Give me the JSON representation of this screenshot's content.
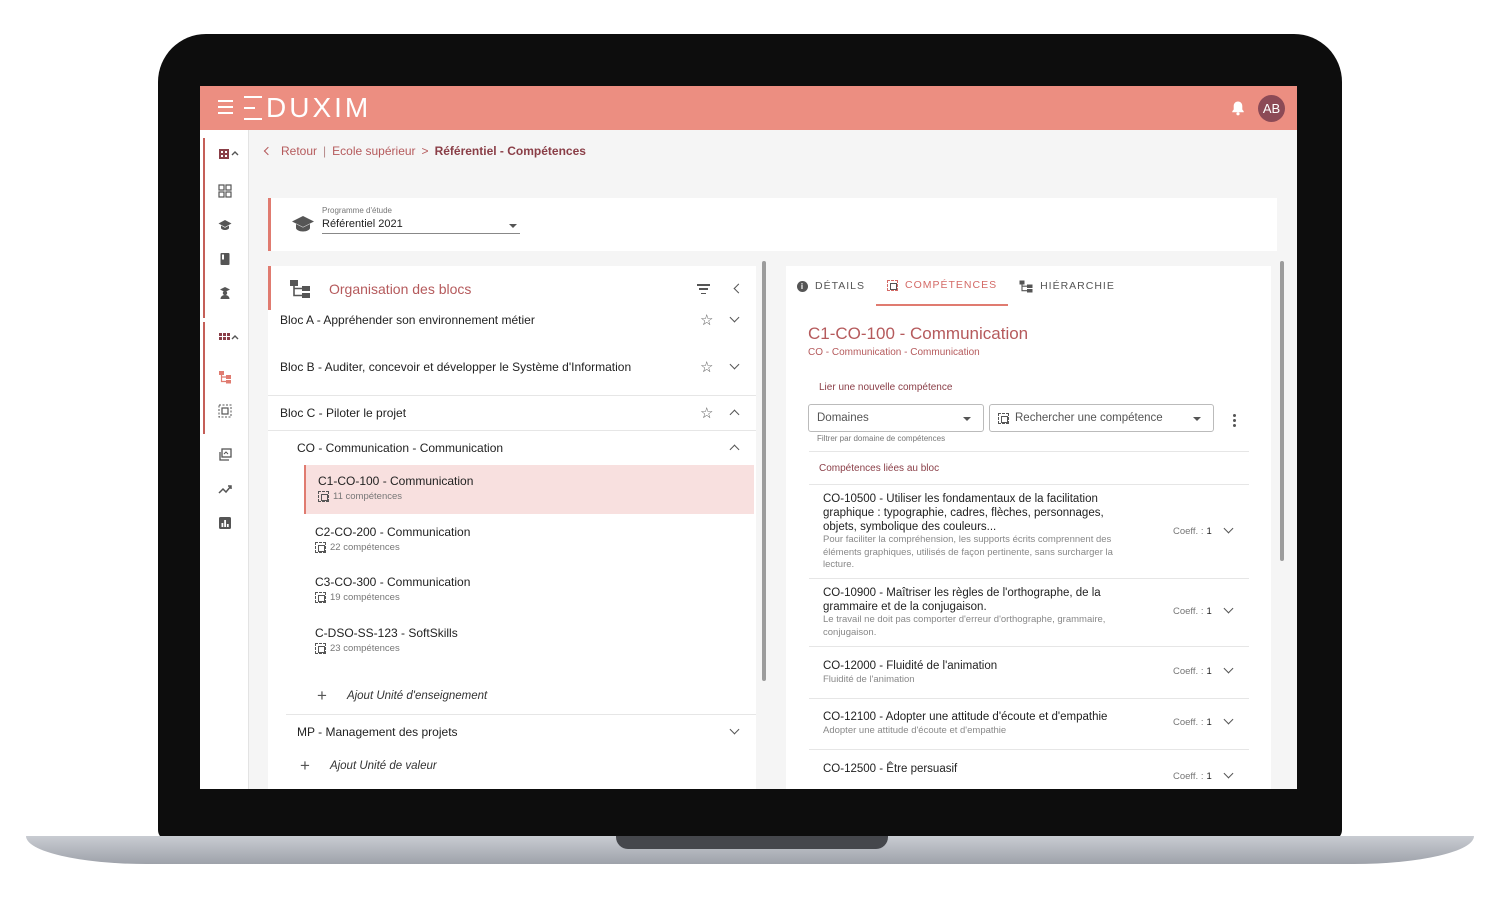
{
  "app": {
    "logo": "DUXIM",
    "user_initials": "AB"
  },
  "breadcrumb": {
    "back": "Retour",
    "sep": "|",
    "school": "Ecole supérieur",
    "arrow": ">",
    "current": "Référentiel - Compétences"
  },
  "program": {
    "label": "Programme d'étude",
    "value": "Référentiel 2021"
  },
  "blocks_panel": {
    "title": "Organisation des blocs",
    "blocs": [
      {
        "label": "Bloc A - Appréhender son environnement métier"
      },
      {
        "label": "Bloc B - Auditer, concevoir et développer le Système d'Information"
      },
      {
        "label": "Bloc C - Piloter le projet"
      }
    ],
    "group": "CO - Communication - Communication",
    "units": [
      {
        "title": "C1-CO-100 - Communication",
        "count": "11 compétences"
      },
      {
        "title": "C2-CO-200 - Communication",
        "count": "22 compétences"
      },
      {
        "title": "C3-CO-300 - Communication",
        "count": "19 compétences"
      },
      {
        "title": "C-DSO-SS-123 - SoftSkills",
        "count": "23 compétences"
      }
    ],
    "add_unit": "Ajout Unité d'enseignement",
    "group2": "MP - Management des projets",
    "add_value": "Ajout Unité de valeur"
  },
  "details_panel": {
    "tabs": [
      "DÉTAILS",
      "COMPÉTENCES",
      "HIÉRARCHIE"
    ],
    "active_tab": "COMPÉTENCES",
    "title": "C1-CO-100 - Communication",
    "subtitle": "CO - Communication - Communication",
    "link_label": "Lier une nouvelle compétence",
    "domains_select": "Domaines",
    "search_select": "Rechercher une compétence",
    "hint": "Filtrer par domaine de compétences",
    "section_title": "Compétences liées au bloc",
    "coeff_label": "Coeff. :",
    "competences": [
      {
        "title": "CO-10500 - Utiliser les fondamentaux de la facilitation graphique : typographie, cadres, flèches, personnages, objets, symbolique des couleurs...",
        "desc": "Pour faciliter la compréhension, les supports écrits comprennent des éléments graphiques, utilisés de façon pertinente, sans surcharger la lecture.",
        "coeff": "1"
      },
      {
        "title": "CO-10900 - Maîtriser les règles de l'orthographe, de la grammaire et de la conjugaison.",
        "desc": "Le travail ne doit pas comporter d'erreur d'orthographe, grammaire, conjugaison.",
        "coeff": "1"
      },
      {
        "title": "CO-12000 - Fluidité de l'animation",
        "desc": "Fluidité de l'animation",
        "coeff": "1"
      },
      {
        "title": "CO-12100 - Adopter une attitude d'écoute et d'empathie",
        "desc": "Adopter une attitude d'écoute et d'empathie",
        "coeff": "1"
      },
      {
        "title": "CO-12500 - Être persuasif",
        "desc": "",
        "coeff": "1"
      }
    ]
  },
  "colors": {
    "topbar": "#ec8e81",
    "accent": "#e07b70",
    "text_accent": "#b55a5c",
    "selected_bg": "#f8e0df",
    "avatar": "#8c4a56"
  }
}
